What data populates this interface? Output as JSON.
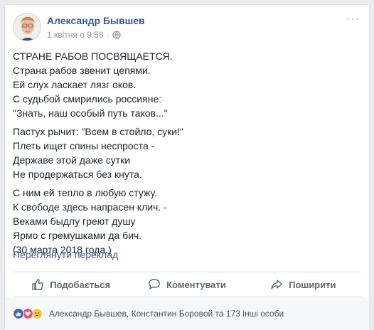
{
  "post": {
    "author": "Александр Бывшев",
    "date": "1 квітня о 9:58",
    "separator": "·",
    "more_label": "···",
    "stanzas": [
      [
        "СТРАНЕ РАБОВ ПОСВЯЩАЕТСЯ.",
        "Страна рабов звенит цепями.",
        "Ей слух ласкает лязг оков.",
        "С судьбой смирились россияне:",
        "\"Знать, наш особый путь таков...\""
      ],
      [
        "Пастух рычит: \"Всем в стойло, суки!\"",
        "Плеть ищет спины неспроста -",
        "Державе этой даже сутки",
        "Не продержаться без кнута."
      ],
      [
        "С ним ей тепло в любую стужу.",
        "К свободе здесь напрасен клич. -",
        "Веками быдлу греют душу",
        "Ярмо с гремушками да бич.",
        "(30 марта 2018 года.)"
      ]
    ],
    "translate_label": "Переглянути переклад"
  },
  "actions": {
    "like_label": "Подобається",
    "comment_label": "Коментувати",
    "share_label": "Поширити"
  },
  "reactions": {
    "names": "Александр Бывшев, Константин Боровой та 173 інші особи"
  },
  "colors": {
    "link": "#365899",
    "meta": "#90949c",
    "action": "#606770"
  }
}
